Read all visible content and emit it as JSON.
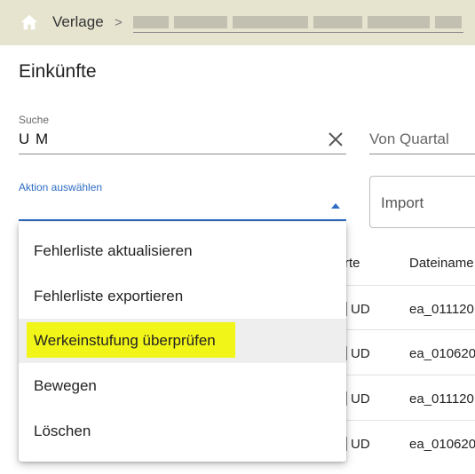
{
  "breadcrumb": {
    "home_icon": "home-icon",
    "items": [
      "Verlage"
    ],
    "separator": ">"
  },
  "page": {
    "title": "Einkünfte"
  },
  "search": {
    "label": "Suche",
    "value": "U M",
    "clear_icon": "close-icon"
  },
  "filter": {
    "from_quarter_placeholder": "Von Quartal"
  },
  "action_select": {
    "label": "Aktion auswählen",
    "caret_icon": "caret-up-icon",
    "accent_color": "#2f6dc4",
    "options": [
      "Fehlerliste aktualisieren",
      "Fehlerliste exportieren",
      "Werkeinstufung überprüfen",
      "Bewegen",
      "Löschen"
    ],
    "hovered_option": "Werkeinstufung überprüfen",
    "highlight_color": "#f2f518"
  },
  "import_button": {
    "label": "Import"
  },
  "table": {
    "headers": [
      "rte",
      "Dateiname"
    ],
    "rows": [
      [
        "UD",
        "ea_011120"
      ],
      [
        "UD",
        "ea_010620"
      ],
      [
        "UD",
        "ea_011120"
      ],
      [
        "UD",
        "ea_010620"
      ]
    ]
  }
}
